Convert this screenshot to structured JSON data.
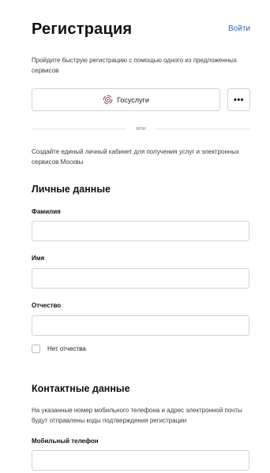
{
  "header": {
    "title": "Регистрация",
    "login_label": "Войти"
  },
  "intro": "Пройдите быструю регистрацию с помощью одного из предложенных сервисов",
  "services": {
    "gosuslugi_label": "Госуслуги",
    "more_label": "•••",
    "gosuslugi_icon": "gosuslugi-logo-icon",
    "more_icon": "more-dots-icon"
  },
  "divider_text": "или",
  "subintro": "Создайте единый личный кабинет для получения услуг и электронных сервисов Москвы",
  "personal": {
    "title": "Личные данные",
    "last_name_label": "Фамилия",
    "last_name_value": "",
    "first_name_label": "Имя",
    "first_name_value": "",
    "middle_name_label": "Отчество",
    "middle_name_value": "",
    "no_middle_name_label": "Нет отчества"
  },
  "contact": {
    "title": "Контактные данные",
    "note": "На указанные номер мобильного телефона и адрес электронной почты будут отправлены коды подтверждения регистрации",
    "phone_label": "Мобильный телефон",
    "phone_value": ""
  },
  "colors": {
    "link": "#2f66c6",
    "border": "#cfd3d8",
    "gos_red": "#d8342b",
    "gos_blue": "#2c5fa8"
  }
}
